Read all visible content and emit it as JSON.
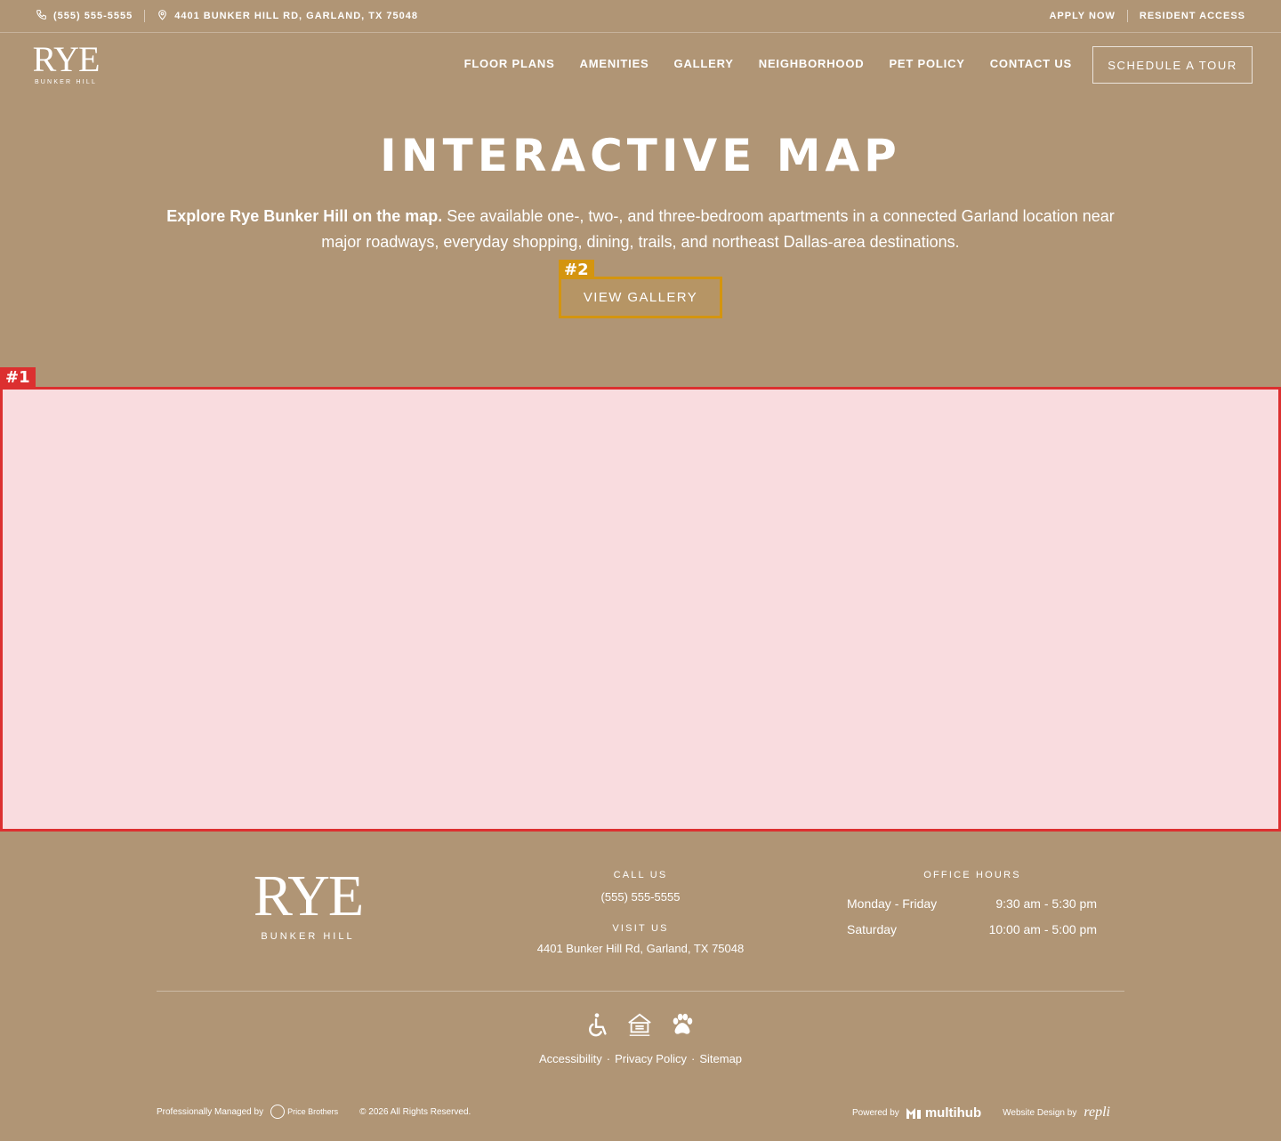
{
  "topbar": {
    "phone": "(555) 555-5555",
    "address": "4401 Bunker Hill Rd, Garland, TX 75048",
    "apply": "Apply Now",
    "resident": "Resident Access"
  },
  "brand": {
    "name": "RYE",
    "sub": "BUNKER HILL"
  },
  "nav": {
    "items": [
      "Floor Plans",
      "Amenities",
      "Gallery",
      "Neighborhood",
      "Pet Policy",
      "Contact Us"
    ],
    "tour_label": "Schedule a Tour"
  },
  "hero": {
    "title": "Interactive Map",
    "lead": "Explore Rye Bunker Hill on the map.",
    "text": " See available one-, two-, and three-bedroom apartments in a connected Garland location near major roadways, everyday shopping, dining, trails, and northeast Dallas-area destinations.",
    "button": "View Gallery"
  },
  "annotations": {
    "tag1": "#1",
    "tag2": "#2"
  },
  "footer": {
    "call_label": "Call Us",
    "phone": "(555) 555-5555",
    "visit_label": "Visit Us",
    "address": "4401 Bunker Hill Rd, Garland, TX 75048",
    "hours_label": "Office Hours",
    "hours": [
      {
        "day": "Monday - Friday",
        "time": "9:30 am - 5:30 pm"
      },
      {
        "day": "Saturday",
        "time": "10:00 am - 5:00 pm"
      }
    ],
    "icons": [
      "accessibility-icon",
      "equal-housing-icon",
      "pet-paw-icon"
    ],
    "links": [
      "Accessibility",
      "Privacy Policy",
      "Sitemap"
    ],
    "managed_by": "Professionally Managed by",
    "manager_name": "Price Brothers",
    "copyright": "© 2026 All Rights Reserved.",
    "powered_by": "Powered by",
    "powered_name": "multihub",
    "design_by": "Website Design by",
    "design_name": "repli"
  },
  "colors": {
    "background": "#b09575",
    "accent": "#d4950f",
    "highlight": "#dc3030",
    "map_fill": "#f9dcdf"
  }
}
